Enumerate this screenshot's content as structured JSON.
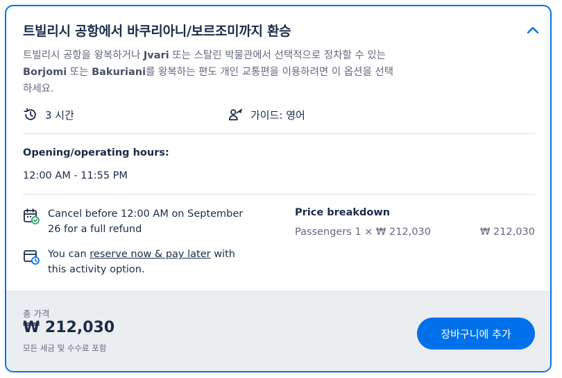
{
  "header": {
    "title": "트빌리시 공항에서 바쿠리아니/보르조미까지 환승",
    "collapse_icon": "chevron-up-icon"
  },
  "description": {
    "part1": "트빌리시 공항을 왕복하거나 ",
    "jvari": "Jvari",
    "part2": " 또는 스탈린 박물관에서 선택적으로 정차할 수 있는 ",
    "borjomi": "Borjomi",
    "part3": " 또는 ",
    "bakuriani": "Bakuriani",
    "part4": "를 왕복하는 편도 개인 교통편을 이용하려면 이 옵션을 선택하세요."
  },
  "meta": {
    "duration": "3 시간",
    "duration_icon": "clock-history-icon",
    "guide": "가이드: 영어",
    "guide_icon": "guide-person-icon"
  },
  "hours": {
    "heading": "Opening/operating hours:",
    "value": "12:00 AM - 11:55 PM"
  },
  "policies": {
    "cancel": {
      "icon": "calendar-check-icon",
      "text": "Cancel before 12:00 AM on September 26 for a full refund"
    },
    "reserve": {
      "icon": "calendar-clock-icon",
      "prefix": "You can ",
      "link": "reserve now & pay later",
      "suffix": " with this activity option."
    }
  },
  "price_breakdown": {
    "title": "Price breakdown",
    "row_label": "Passengers 1 × ₩ 212,030",
    "row_value": "₩ 212,030"
  },
  "footer": {
    "total_label": "총 가격",
    "total_price": "₩ 212,030",
    "note": "모든 세금 및 수수료 포함",
    "add_button": "장바구니에 추가"
  },
  "colors": {
    "accent": "#0071eb",
    "text_primary": "#1a2b49",
    "text_secondary": "#63687a",
    "footer_bg": "#ebeef1",
    "success": "#2fa36b"
  }
}
